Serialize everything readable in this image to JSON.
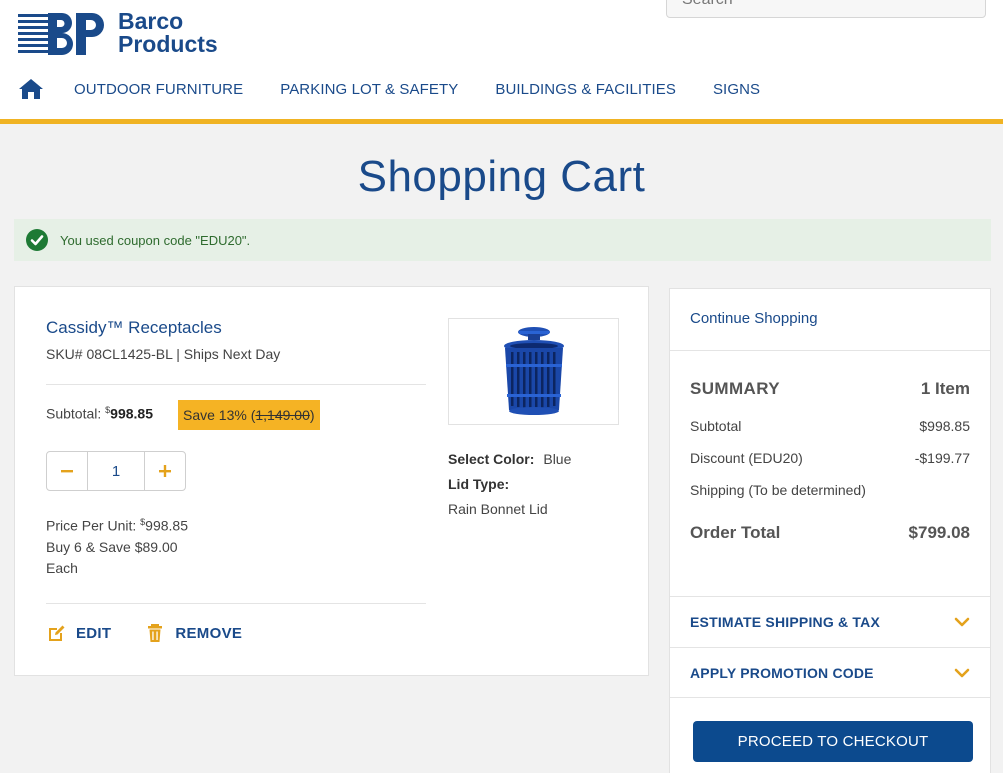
{
  "header": {
    "logo_line1": "Barco",
    "logo_line2": "Products",
    "search_placeholder": "Search",
    "nav": [
      "OUTDOOR FURNITURE",
      "PARKING LOT & SAFETY",
      "BUILDINGS & FACILITIES",
      "SIGNS"
    ]
  },
  "page_title": "Shopping Cart",
  "coupon_message": "You used coupon code \"EDU20\".",
  "item": {
    "name": "Cassidy™ Receptacles",
    "sku_line": "SKU# 08CL1425-BL | Ships Next Day",
    "subtotal_label": "Subtotal:",
    "subtotal_currency": "$",
    "subtotal_value": "998.85",
    "save_label": "Save 13% (",
    "save_original": "1,149.00",
    "save_close": ")",
    "quantity": "1",
    "price_per_unit_label": "Price Per Unit:",
    "price_per_unit_currency": "$",
    "price_per_unit_value": "998.85",
    "bulk_line1": "Buy 6 & Save $89.00",
    "bulk_line2": "Each",
    "edit_label": "EDIT",
    "remove_label": "REMOVE",
    "color_label": "Select Color:",
    "color_value": "Blue",
    "lid_label": "Lid Type:",
    "lid_value": "Rain Bonnet Lid"
  },
  "summary": {
    "continue_label": "Continue Shopping",
    "title": "SUMMARY",
    "count": "1 Item",
    "rows": [
      {
        "label": "Subtotal",
        "value": "$998.85"
      },
      {
        "label": "Discount (EDU20)",
        "value": "-$199.77"
      },
      {
        "label": "Shipping (To be determined)",
        "value": ""
      }
    ],
    "total_label": "Order Total",
    "total_value": "$799.08",
    "estimate_label": "ESTIMATE SHIPPING & TAX",
    "promo_label": "APPLY PROMOTION CODE",
    "checkout_label": "PROCEED TO CHECKOUT"
  },
  "colors": {
    "brand_blue": "#1a4a8a",
    "accent_gold": "#f0b323",
    "checkout_blue": "#0c4a8e",
    "success_green": "#1e7a35"
  }
}
